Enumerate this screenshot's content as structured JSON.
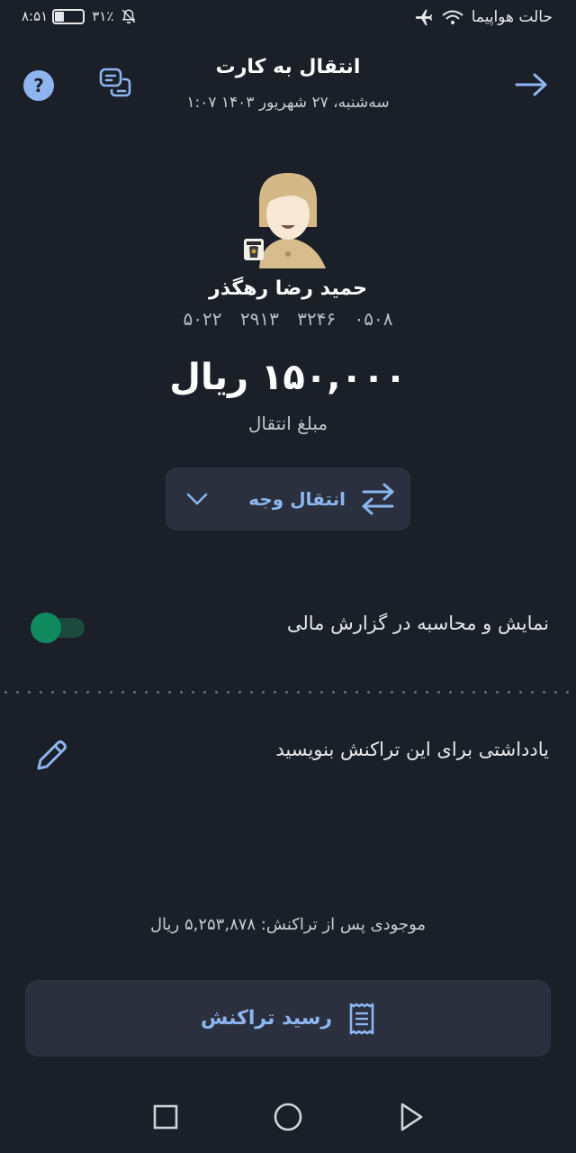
{
  "status_bar": {
    "time": "۸:۵۱",
    "battery": "۳۱٪",
    "airplane_mode_label": "حالت هواپیما"
  },
  "header": {
    "title": "انتقال به کارت",
    "datetime": "سه‌شنبه، ۲۷ شهریور ۱۴۰۳   ۱:۰۷"
  },
  "recipient": {
    "name": "حمید رضا رهگذر",
    "card_number": "۵۰۲۲ ۲۹۱۳ ۳۲۴۶ ۰۵۰۸"
  },
  "transfer": {
    "amount": "۱۵۰,۰۰۰ ریال",
    "amount_label": "مبلغ انتقال",
    "type_label": "انتقال وجه"
  },
  "report_toggle": {
    "label": "نمایش و محاسبه در گزارش مالی",
    "enabled": true
  },
  "note": {
    "placeholder": "یادداشتی برای این تراکنش بنویسید"
  },
  "balance_after": "موجودی پس از تراکنش: ۵,۲۵۳,۸۷۸ ریال",
  "receipt_button": {
    "label": "رسید تراکنش"
  },
  "colors": {
    "background": "#1b1f27",
    "accent": "#8db6f0",
    "toggle_on": "#0f8a5f",
    "surface": "#2a303d"
  }
}
